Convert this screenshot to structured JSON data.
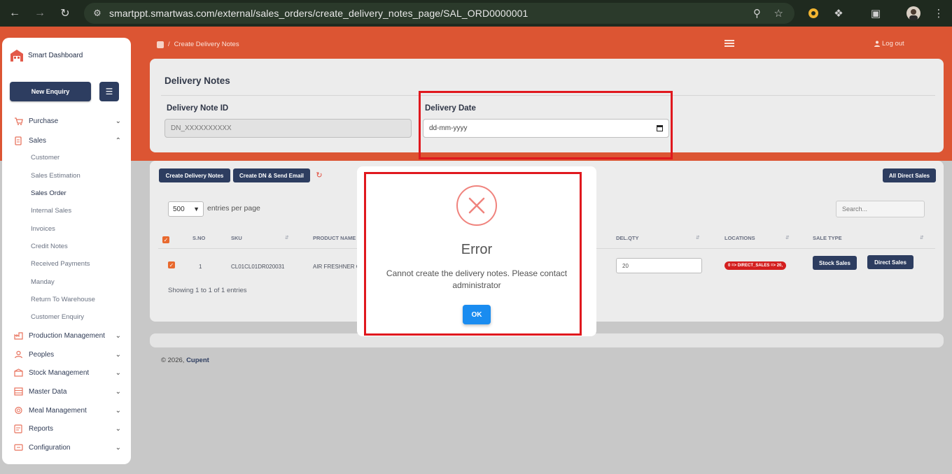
{
  "browser": {
    "url": "smartppt.smartwas.com/external/sales_orders/create_delivery_notes_page/SAL_ORD0000001"
  },
  "sidebar": {
    "brand": "Smart Dashboard",
    "new_enquiry": "New Enquiry",
    "items": [
      {
        "label": "Purchase"
      },
      {
        "label": "Sales"
      },
      {
        "label": "Production Management"
      },
      {
        "label": "Peoples"
      },
      {
        "label": "Stock Management"
      },
      {
        "label": "Master Data"
      },
      {
        "label": "Meal Management"
      },
      {
        "label": "Reports"
      },
      {
        "label": "Configuration"
      }
    ],
    "sales_sub": [
      "Customer",
      "Sales Estimation",
      "Sales Order",
      "Internal Sales",
      "Invoices",
      "Credit Notes",
      "Received Payments",
      "Manday",
      "Return To Warehouse",
      "Customer Enquiry"
    ]
  },
  "topbar": {
    "breadcrumb": "Create Delivery Notes",
    "logout": "Log out"
  },
  "form": {
    "title": "Delivery Notes",
    "dn_id_label": "Delivery Note ID",
    "dn_id_value": "DN_XXXXXXXXXX",
    "date_label": "Delivery Date",
    "date_placeholder": "dd-mm-yyyy"
  },
  "table_card": {
    "btn_create": "Create Delivery Notes",
    "btn_create_email": "Create DN & Send Email",
    "btn_all_direct": "All Direct Sales",
    "page_length": "500",
    "entries_label": "entries per page",
    "search_placeholder": "Search...",
    "columns": [
      "S.NO",
      "SKU",
      "PRODUCT NAME",
      "DEL.QTY",
      "LOCATIONS",
      "SALE TYPE"
    ],
    "row": {
      "sno": "1",
      "sku": "CL01CL01DR020031",
      "product": "AIR FRESHNER G",
      "qty": "20",
      "location": "0 => DIRECT_SALES => 20,",
      "stock_sales": "Stock Sales",
      "direct_sales": "Direct Sales"
    },
    "showing": "Showing 1 to 1 of 1 entries"
  },
  "footer": {
    "prefix": "© 2026,",
    "company": "Cupent"
  },
  "modal": {
    "title": "Error",
    "message": "Cannot create the delivery notes. Please contact administrator",
    "ok": "OK"
  }
}
